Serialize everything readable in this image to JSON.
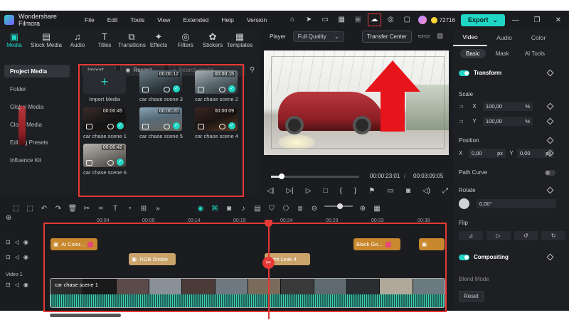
{
  "app": {
    "title": "Wondershare Filmora",
    "menu": [
      "File",
      "Edit",
      "Tools",
      "View",
      "Extended",
      "Help",
      "Version"
    ],
    "credits": "72716",
    "export_label": "Export"
  },
  "media_tabs": [
    "Media",
    "Stock Media",
    "Audio",
    "Titles",
    "Transitions",
    "Effects",
    "Filters",
    "Stickers",
    "Templates"
  ],
  "sidebar": [
    "Project Media",
    "Folder",
    "Global Media",
    "Cloud Media",
    "Editing Presets",
    "Influence Kit"
  ],
  "media_toolbar": {
    "import": "Import",
    "record": "Record",
    "search_placeholder": "Search media"
  },
  "media_items": [
    {
      "label": "Import Media"
    },
    {
      "label": "car chase scene 3",
      "duration": "00:00:12"
    },
    {
      "label": "car chase scene 2",
      "duration": "00:00:15"
    },
    {
      "label": "car chase scene 1",
      "duration": "00:00:45"
    },
    {
      "label": "car chase scene 5",
      "duration": "00:00:20"
    },
    {
      "label": "car chase scene 4",
      "duration": "00:00:09"
    },
    {
      "label": "car chase scene 6",
      "duration": "00:00:42"
    }
  ],
  "player": {
    "label": "Player",
    "quality": "Full Quality",
    "tooltip": "Transfer Center",
    "current_time": "00:00:23:01",
    "total_time": "00:03:09:05",
    "progress": 0.12
  },
  "right_panel": {
    "tabs": [
      "Video",
      "Audio",
      "Color"
    ],
    "subtabs": [
      "Basic",
      "Mask",
      "AI Tools"
    ],
    "transform": "Transform",
    "scale": "Scale",
    "scale_x": "100,00",
    "scale_y": "100,00",
    "pct": "%",
    "position": "Position",
    "pos_x": "0,00",
    "pos_y": "0,00",
    "px": "px",
    "curve": "Path Curve",
    "rotate": "Rotate",
    "rotate_value": "0,00°",
    "flip": "Flip",
    "compositing": "Compositing",
    "blend_mode": "Blend Mode",
    "reset": "Reset",
    "x": "X",
    "y": "Y"
  },
  "ruler": [
    "00:04",
    "00:09",
    "00:14",
    "00:19",
    "00:24",
    "00:29",
    "00:33",
    "00:38"
  ],
  "clips": {
    "ai_color": "AI Color...",
    "black_go": "Black Go...",
    "rgb_stroke": "RGB Stroke",
    "light_leak": "Light Leak 4",
    "video": "car chase scene 1"
  },
  "tracks": {
    "video_label": "Video 1"
  }
}
